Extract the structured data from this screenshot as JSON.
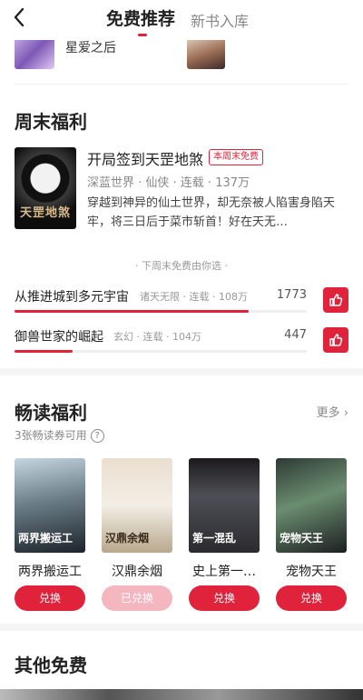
{
  "header": {
    "tabs": [
      {
        "label": "免费推荐",
        "active": true
      },
      {
        "label": "新书入库",
        "active": false
      }
    ]
  },
  "top_row": {
    "title": "星爱之后"
  },
  "weekend": {
    "section_title": "周末福利",
    "book": {
      "cover_text": "天罡地煞",
      "title": "开局签到天罡地煞",
      "badge": "本周末免费",
      "meta": "深蓝世界 · 仙侠 · 连载 · 137万",
      "desc": "穿越到神异的仙土世界，却无奈被人陷害身陷天牢，将三日后于菜市斩首！好在天无…"
    },
    "vote_hint": "· 下周末免费由你选 ·",
    "votes": [
      {
        "title": "从推进城到多元宇宙",
        "meta": "诸天无限 · 连载 · 108万",
        "count": "1773",
        "fill": 0.8
      },
      {
        "title": "御兽世家的崛起",
        "meta": "玄幻 · 连载 · 104万",
        "count": "447",
        "fill": 0.2
      }
    ]
  },
  "reading": {
    "section_title": "畅读福利",
    "more": "更多 ›",
    "coupon": "3张畅读券可用",
    "qmark": "?",
    "books": [
      {
        "title": "两界搬运工",
        "button": "兑换",
        "redeemed": false,
        "cover_text": "两界搬运工"
      },
      {
        "title": "汉鼎余烟",
        "button": "已兑换",
        "redeemed": true,
        "cover_text": "汉鼎余烟"
      },
      {
        "title": "史上第一…",
        "button": "兑换",
        "redeemed": false,
        "cover_text": "第一混乱"
      },
      {
        "title": "宠物天王",
        "button": "兑换",
        "redeemed": false,
        "cover_text": "宠物天王"
      }
    ]
  },
  "other": {
    "section_title": "其他免费"
  },
  "colors": {
    "accent": "#e0233a",
    "accent_light": "#f4b7c0"
  }
}
